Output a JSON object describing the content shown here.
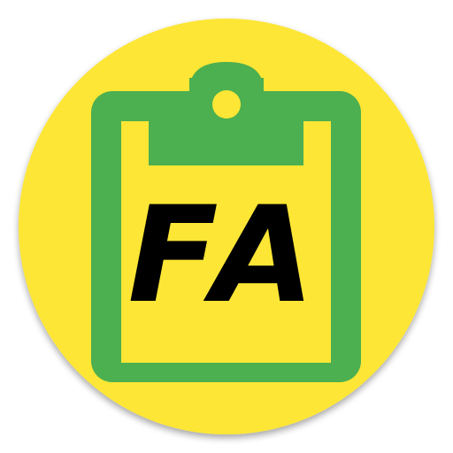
{
  "icon": {
    "name": "clipboard-icon",
    "text": "FA",
    "colors": {
      "circle": "#FDE635",
      "circle_shadow": "#D8C62C",
      "clipboard": "#4CAF50",
      "paper": "#FDE635",
      "text": "#000000",
      "background": "#FFFFFF"
    }
  }
}
